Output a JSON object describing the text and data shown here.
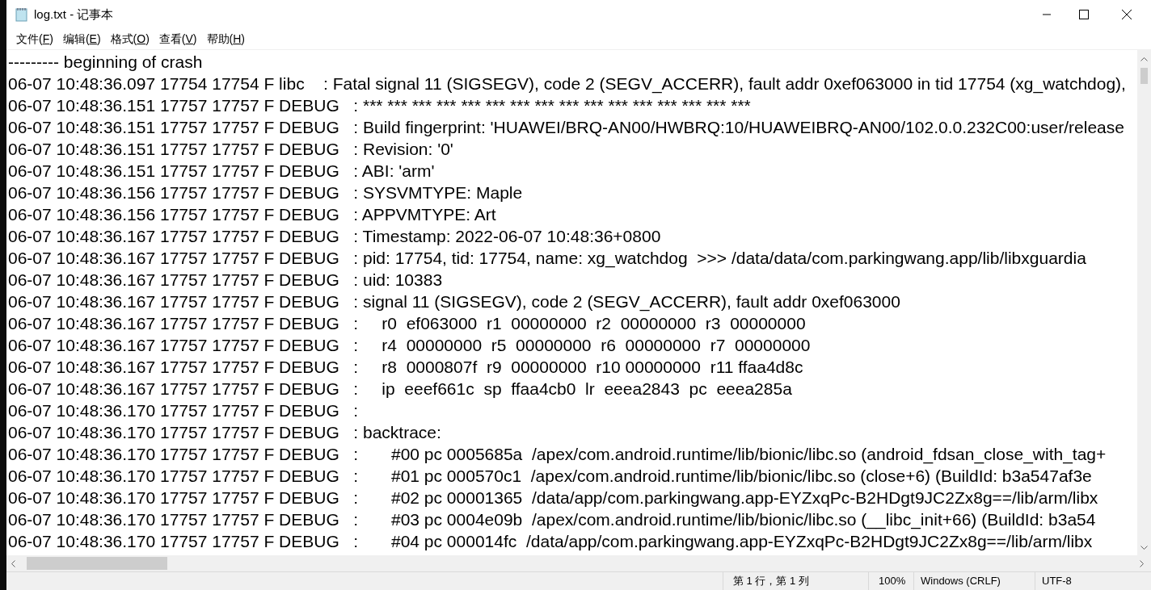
{
  "window": {
    "title": "log.txt - 记事本"
  },
  "menu": [
    "文件(F)",
    "编辑(E)",
    "格式(O)",
    "查看(V)",
    "帮助(H)"
  ],
  "lines": [
    "--------- beginning of crash",
    "06-07 10:48:36.097 17754 17754 F libc    : Fatal signal 11 (SIGSEGV), code 2 (SEGV_ACCERR), fault addr 0xef063000 in tid 17754 (xg_watchdog),",
    "06-07 10:48:36.151 17757 17757 F DEBUG   : *** *** *** *** *** *** *** *** *** *** *** *** *** *** *** ***",
    "06-07 10:48:36.151 17757 17757 F DEBUG   : Build fingerprint: 'HUAWEI/BRQ-AN00/HWBRQ:10/HUAWEIBRQ-AN00/102.0.0.232C00:user/release",
    "06-07 10:48:36.151 17757 17757 F DEBUG   : Revision: '0'",
    "06-07 10:48:36.151 17757 17757 F DEBUG   : ABI: 'arm'",
    "06-07 10:48:36.156 17757 17757 F DEBUG   : SYSVMTYPE: Maple",
    "06-07 10:48:36.156 17757 17757 F DEBUG   : APPVMTYPE: Art",
    "06-07 10:48:36.167 17757 17757 F DEBUG   : Timestamp: 2022-06-07 10:48:36+0800",
    "06-07 10:48:36.167 17757 17757 F DEBUG   : pid: 17754, tid: 17754, name: xg_watchdog  >>> /data/data/com.parkingwang.app/lib/libxguardia",
    "06-07 10:48:36.167 17757 17757 F DEBUG   : uid: 10383",
    "06-07 10:48:36.167 17757 17757 F DEBUG   : signal 11 (SIGSEGV), code 2 (SEGV_ACCERR), fault addr 0xef063000",
    "06-07 10:48:36.167 17757 17757 F DEBUG   :     r0  ef063000  r1  00000000  r2  00000000  r3  00000000",
    "06-07 10:48:36.167 17757 17757 F DEBUG   :     r4  00000000  r5  00000000  r6  00000000  r7  00000000",
    "06-07 10:48:36.167 17757 17757 F DEBUG   :     r8  0000807f  r9  00000000  r10 00000000  r11 ffaa4d8c",
    "06-07 10:48:36.167 17757 17757 F DEBUG   :     ip  eeef661c  sp  ffaa4cb0  lr  eeea2843  pc  eeea285a",
    "06-07 10:48:36.170 17757 17757 F DEBUG   :",
    "06-07 10:48:36.170 17757 17757 F DEBUG   : backtrace:",
    "06-07 10:48:36.170 17757 17757 F DEBUG   :       #00 pc 0005685a  /apex/com.android.runtime/lib/bionic/libc.so (android_fdsan_close_with_tag+",
    "06-07 10:48:36.170 17757 17757 F DEBUG   :       #01 pc 000570c1  /apex/com.android.runtime/lib/bionic/libc.so (close+6) (BuildId: b3a547af3e",
    "06-07 10:48:36.170 17757 17757 F DEBUG   :       #02 pc 00001365  /data/app/com.parkingwang.app-EYZxqPc-B2HDgt9JC2Zx8g==/lib/arm/libx",
    "06-07 10:48:36.170 17757 17757 F DEBUG   :       #03 pc 0004e09b  /apex/com.android.runtime/lib/bionic/libc.so (__libc_init+66) (BuildId: b3a54",
    "06-07 10:48:36.170 17757 17757 F DEBUG   :       #04 pc 000014fc  /data/app/com.parkingwang.app-EYZxqPc-B2HDgt9JC2Zx8g==/lib/arm/libx"
  ],
  "status_bar": {
    "position": "第 1 行，第 1 列",
    "zoom": "100%",
    "line_ending": "Windows (CRLF)",
    "encoding": "UTF-8"
  }
}
